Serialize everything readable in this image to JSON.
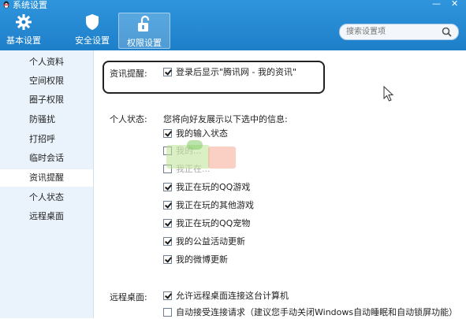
{
  "window": {
    "title": "系统设置",
    "minimize_label": "—",
    "close_label": "✕"
  },
  "tabs": [
    {
      "label": "基本设置",
      "icon": "gear-icon"
    },
    {
      "label": "安全设置",
      "icon": "shield-icon"
    },
    {
      "label": "权限设置",
      "icon": "unlock-icon",
      "active": true
    }
  ],
  "search": {
    "placeholder": "搜索设置项",
    "icon": "search-icon"
  },
  "sidebar": {
    "items": [
      {
        "label": "个人资料"
      },
      {
        "label": "空间权限"
      },
      {
        "label": "圈子权限"
      },
      {
        "label": "防骚扰"
      },
      {
        "label": "打招呼"
      },
      {
        "label": "临时会话"
      },
      {
        "label": "资讯提醒",
        "active": true
      },
      {
        "label": "个人状态"
      },
      {
        "label": "远程桌面"
      }
    ]
  },
  "content": {
    "news": {
      "section_label": "资讯提醒:",
      "option": {
        "label": "登录后显示\"腾讯网 - 我的资讯\"",
        "checked": true
      }
    },
    "status": {
      "section_label": "个人状态:",
      "description": "您将向好友展示以下选中的信息:",
      "options": [
        {
          "label": "我的输入状态",
          "checked": true
        },
        {
          "label": "我的...",
          "checked": false
        },
        {
          "label": "我正在...",
          "checked": false
        },
        {
          "label": "我正在玩的QQ游戏",
          "checked": true
        },
        {
          "label": "我正在玩的其他游戏",
          "checked": true
        },
        {
          "label": "我正在玩的QQ宠物",
          "checked": true
        },
        {
          "label": "我的公益活动更新",
          "checked": true
        },
        {
          "label": "我的微博更新",
          "checked": true
        }
      ]
    },
    "remote": {
      "section_label": "远程桌面:",
      "options": [
        {
          "label": "允许远程桌面连接这台计算机",
          "checked": true
        },
        {
          "label": "自动接受连接请求（建议您手动关闭Windows自动睡眠和自动锁屏功能）",
          "checked": false
        }
      ]
    }
  },
  "colors": {
    "header": "#1e7fc9",
    "sidebar_bg": "#eaf3fb",
    "accent": "#2f95dd"
  }
}
